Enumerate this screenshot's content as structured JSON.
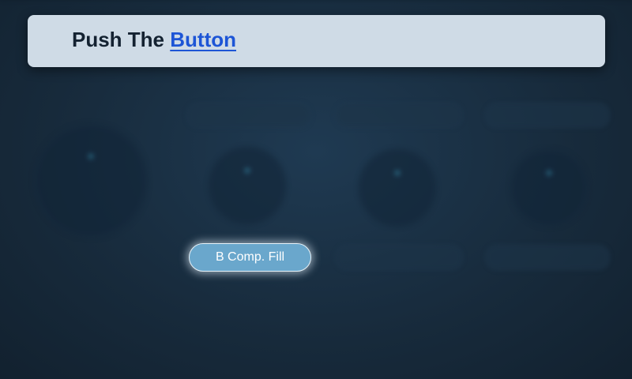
{
  "header": {
    "prefix": "Push The",
    "link": "Button"
  },
  "target_button": {
    "label": "B Comp. Fill"
  },
  "colors": {
    "accent_link": "#1d55d6",
    "button_fill": "#6aa7cc",
    "header_card": "#cfdbe6",
    "background": "#1a2c3d"
  },
  "background_icons": [
    "gauge-icon",
    "home-icon",
    "document-icon",
    "diamond-icon",
    "grid-icon",
    "gear-icon"
  ]
}
